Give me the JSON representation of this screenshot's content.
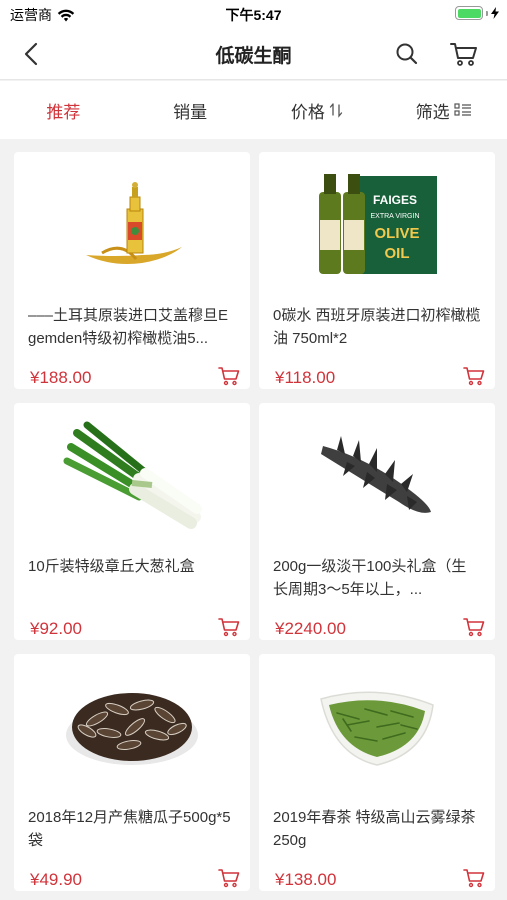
{
  "status_bar": {
    "carrier": "运营商",
    "time": "下午5:47",
    "battery_color": "#4cd964"
  },
  "nav": {
    "title": "低碳生酮",
    "back_icon": "chevron-left-icon",
    "search_icon": "search-icon",
    "cart_icon": "cart-icon"
  },
  "tabs": [
    {
      "label": "推荐",
      "active": true
    },
    {
      "label": "销量",
      "active": false
    },
    {
      "label": "价格",
      "active": false,
      "icon": "sort-icon"
    },
    {
      "label": "筛选",
      "active": false,
      "icon": "filter-list-icon"
    }
  ],
  "accent_color": "#d0343b",
  "products": [
    {
      "name": "–––土耳其原装进口艾盖穆旦Egemden特级初榨橄榄油5...",
      "price": "¥188.00"
    },
    {
      "name": "0碳水 西班牙原装进口初榨橄榄油 750ml*2",
      "price": "¥118.00",
      "image_text": {
        "brand": "FAIGES",
        "line": "EXTRA VIRGIN",
        "big": "OLIVE",
        "big2": "OIL"
      }
    },
    {
      "name": "10斤装特级章丘大葱礼盒",
      "price": "¥92.00"
    },
    {
      "name": "200g一级淡干100头礼盒（生长周期3～5年以上，...",
      "price": "¥2240.00"
    },
    {
      "name": "2018年12月产焦糖瓜子500g*5袋",
      "price": "¥49.90"
    },
    {
      "name": "2019年春茶 特级高山云雾绿茶 250g",
      "price": "¥138.00"
    }
  ]
}
